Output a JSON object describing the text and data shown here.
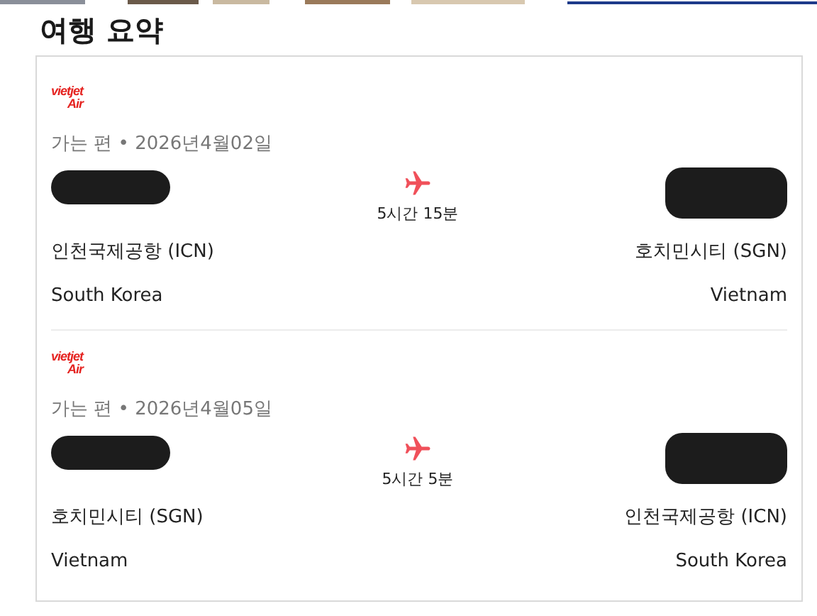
{
  "title": "여행 요약",
  "segments": [
    {
      "airline": {
        "line1": "vietjet",
        "line2": "Air"
      },
      "date_line": "가는 편 • 2026년4월02일",
      "duration": "5시간 15분",
      "from": {
        "airport": "인천국제공항 (ICN)",
        "country": "South Korea"
      },
      "to": {
        "airport": "호치민시티 (SGN)",
        "country": "Vietnam"
      }
    },
    {
      "airline": {
        "line1": "vietjet",
        "line2": "Air"
      },
      "date_line": "가는 편 • 2026년4월05일",
      "duration": "5시간 5분",
      "from": {
        "airport": "호치민시티 (SGN)",
        "country": "Vietnam"
      },
      "to": {
        "airport": "인천국제공항 (ICN)",
        "country": "South Korea"
      }
    }
  ]
}
